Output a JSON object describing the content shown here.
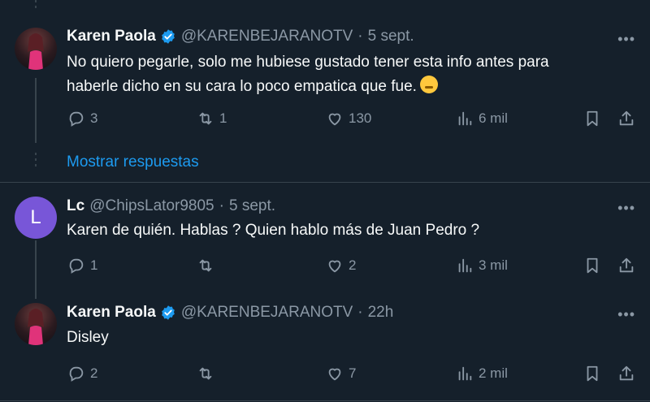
{
  "colors": {
    "background": "#15202b",
    "text": "#f7f9f9",
    "muted": "#8b98a5",
    "accent": "#1d9bf0",
    "verified": "#1d9bf0",
    "avatar_lc": "#7856d8"
  },
  "tweets": [
    {
      "name": "Karen Paola",
      "handle": "@KARENBEJARANOTV",
      "sep": "·",
      "time": "5 sept.",
      "verified": true,
      "avatar": "photo",
      "text_line1": "No quiero pegarle, solo me hubiese gustado tener esta info antes para",
      "text_line2": "haberle dicho en su cara lo poco empatica que fue.",
      "emoji": "frustrated-face-emoji",
      "replies": "3",
      "retweets": "1",
      "likes": "130",
      "views": "6 mil",
      "show_replies": "Mostrar respuestas"
    },
    {
      "name": "Lc",
      "handle": "@ChipsLator9805",
      "sep": "·",
      "time": "5 sept.",
      "verified": false,
      "avatar_letter": "L",
      "text_line1": "Karen de quién. Hablas ? Quien hablo más de Juan Pedro ?",
      "replies": "1",
      "retweets": "",
      "likes": "2",
      "views": "3 mil"
    },
    {
      "name": "Karen Paola",
      "handle": "@KARENBEJARANOTV",
      "sep": "·",
      "time": "22h",
      "verified": true,
      "avatar": "photo",
      "text_line1": "Disley",
      "replies": "2",
      "retweets": "",
      "likes": "7",
      "views": "2 mil"
    }
  ],
  "icons": [
    "reply-icon",
    "retweet-icon",
    "like-icon",
    "views-icon",
    "bookmark-icon",
    "share-icon",
    "more-icon",
    "verified-icon"
  ]
}
